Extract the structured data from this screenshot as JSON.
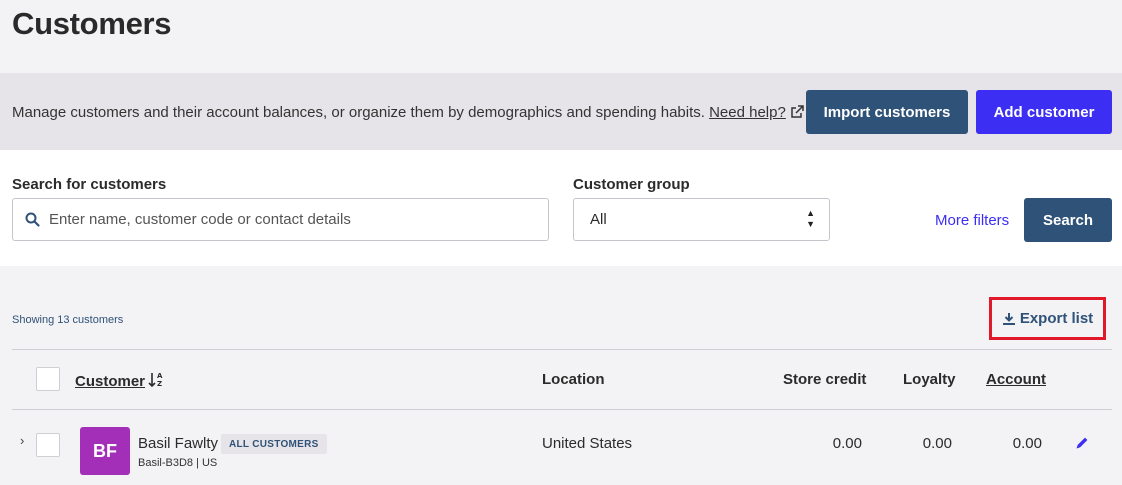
{
  "page": {
    "title": "Customers"
  },
  "intro": {
    "description": "Manage customers and their account balances, or organize them by demographics and spending habits.",
    "help_link": "Need help?",
    "help_icon": "external-link-icon",
    "import_button": "Import customers",
    "add_button": "Add customer"
  },
  "filters": {
    "search_label": "Search for customers",
    "search_placeholder": "Enter name, customer code or contact details",
    "search_value": "",
    "group_label": "Customer group",
    "group_value": "All",
    "more_filters": "More filters",
    "search_button": "Search"
  },
  "results": {
    "count_text": "Showing 13 customers",
    "export_button": "Export list",
    "export_icon": "download-icon"
  },
  "table": {
    "columns": {
      "customer": "Customer",
      "location": "Location",
      "store_credit": "Store credit",
      "loyalty": "Loyalty",
      "account": "Account"
    },
    "rows": [
      {
        "initials": "BF",
        "avatar_color": "#a32eb8",
        "name": "Basil Fawlty",
        "group_badge": "ALL CUSTOMERS",
        "code": "Basil-B3D8 | US",
        "location": "United States",
        "store_credit": "0.00",
        "loyalty": "0.00",
        "account": "0.00"
      }
    ]
  },
  "colors": {
    "primary_dark": "#2f5278",
    "primary_accent": "#3c2ef2",
    "highlight": "#e0182a"
  }
}
